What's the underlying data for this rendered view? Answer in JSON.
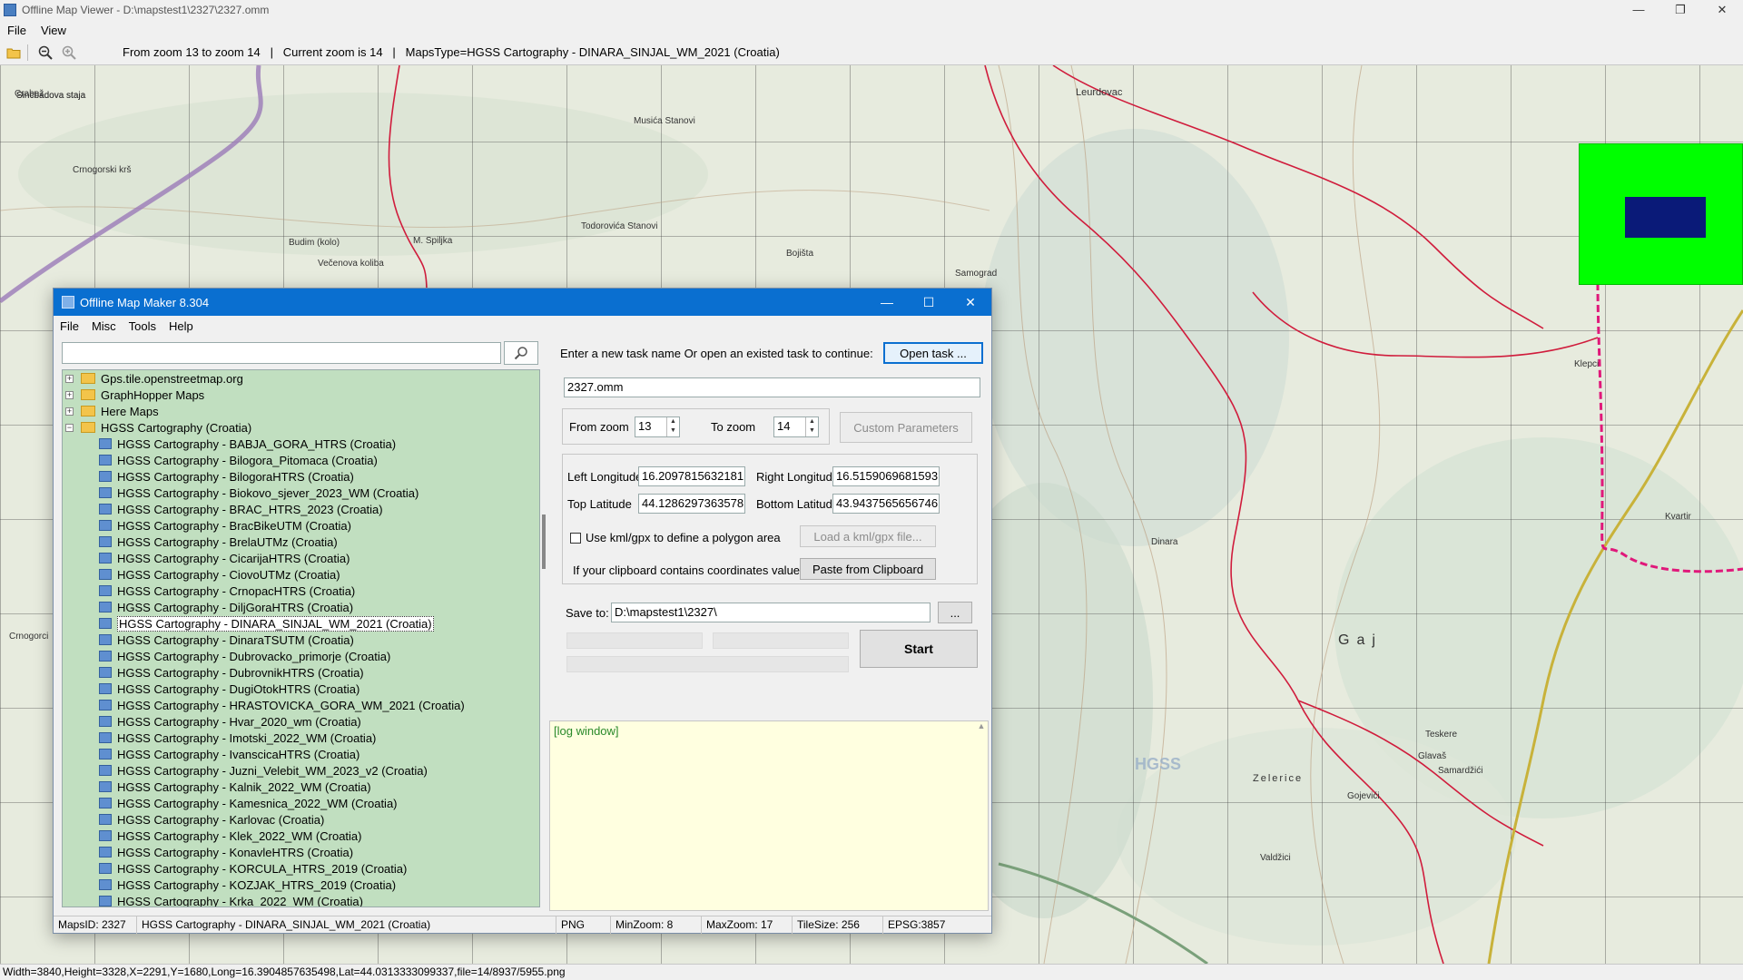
{
  "viewer": {
    "title": "Offline Map Viewer - D:\\mapstest1\\2327\\2327.omm",
    "menu": [
      "File",
      "View"
    ],
    "toolbar_info": "From zoom 13 to zoom 14   |   Current zoom is 14   |   MapsType=HGSS Cartography - DINARA_SINJAL_WM_2021 (Croatia)",
    "status": "Width=3840,Height=3328,X=2291,Y=1680,Long=16.3904857635498,Lat=44.0313333099337,file=14/8937/5955.png",
    "window_controls": [
      "—",
      "❐",
      "✕"
    ]
  },
  "map_labels": [
    "Sincbadova staja",
    "Crabež",
    "Crnogorski krš",
    "Budim (kolo)",
    "Večenova koliba",
    "M. Spiljka",
    "Todorovića Stanovi",
    "Musića Stanovi",
    "Bojišta",
    "Samograd",
    "Leurdovac",
    "Crnogorci",
    "Kvartir",
    "Klepci",
    "Glavaš",
    "Samardžići",
    "Teskere",
    "Valdžici",
    "Zelerice",
    "Gojevići",
    "Gaj",
    "Dinara",
    "HGSS"
  ],
  "dialog": {
    "title": "Offline Map Maker 8.304",
    "menu": [
      "File",
      "Misc",
      "Tools",
      "Help"
    ],
    "search_value": "",
    "tree": {
      "groups": [
        {
          "label": "Gps.tile.openstreetmap.org",
          "expanded": false
        },
        {
          "label": "GraphHopper Maps",
          "expanded": false
        },
        {
          "label": "Here Maps",
          "expanded": false
        },
        {
          "label": "HGSS Cartography (Croatia)",
          "expanded": true
        }
      ],
      "items": [
        "HGSS Cartography - BABJA_GORA_HTRS (Croatia)",
        "HGSS Cartography - Bilogora_Pitomaca (Croatia)",
        "HGSS Cartography - BilogoraHTRS (Croatia)",
        "HGSS Cartography - Biokovo_sjever_2023_WM (Croatia)",
        "HGSS Cartography - BRAC_HTRS_2023 (Croatia)",
        "HGSS Cartography - BracBikeUTM (Croatia)",
        "HGSS Cartography - BrelaUTMz (Croatia)",
        "HGSS Cartography - CicarijaHTRS (Croatia)",
        "HGSS Cartography - CiovoUTMz (Croatia)",
        "HGSS Cartography - CrnopacHTRS (Croatia)",
        "HGSS Cartography - DiljGoraHTRS (Croatia)",
        "HGSS Cartography - DINARA_SINJAL_WM_2021 (Croatia)",
        "HGSS Cartography - DinaraTSUTM (Croatia)",
        "HGSS Cartography - Dubrovacko_primorje (Croatia)",
        "HGSS Cartography - DubrovnikHTRS (Croatia)",
        "HGSS Cartography - DugiOtokHTRS (Croatia)",
        "HGSS Cartography - HRASTOVICKA_GORA_WM_2021 (Croatia)",
        "HGSS Cartography - Hvar_2020_wm (Croatia)",
        "HGSS Cartography - Imotski_2022_WM (Croatia)",
        "HGSS Cartography - IvanscicaHTRS (Croatia)",
        "HGSS Cartography - Juzni_Velebit_WM_2023_v2 (Croatia)",
        "HGSS Cartography - Kalnik_2022_WM (Croatia)",
        "HGSS Cartography - Kamesnica_2022_WM (Croatia)",
        "HGSS Cartography - Karlovac (Croatia)",
        "HGSS Cartography - Klek_2022_WM (Croatia)",
        "HGSS Cartography - KonavleHTRS (Croatia)",
        "HGSS Cartography - KORCULA_HTRS_2019 (Croatia)",
        "HGSS Cartography - KOZJAK_HTRS_2019 (Croatia)",
        "HGSS Cartography - Krka_2022_WM (Croatia)"
      ],
      "selected_index": 11
    },
    "task_prompt": "Enter a new task name Or open an existed task to continue:",
    "open_task_label": "Open task ...",
    "task_name": "2327.omm",
    "from_zoom_label": "From zoom",
    "from_zoom": "13",
    "to_zoom_label": "To zoom",
    "to_zoom": "14",
    "custom_params_label": "Custom Parameters",
    "left_lon_label": "Left Longitude",
    "left_lon": "16.2097815632181",
    "right_lon_label": "Right Longitude",
    "right_lon": "16.5159069681593",
    "top_lat_label": "Top Latitude",
    "top_lat": "44.1286297363578",
    "bottom_lat_label": "Bottom Latitude",
    "bottom_lat": "43.9437565656746",
    "kml_label": "Use kml/gpx to define a polygon area",
    "kml_checked": false,
    "load_kml_label": "Load a kml/gpx file...",
    "clipboard_label": "If your clipboard contains coordinates values:",
    "paste_label": "Paste from Clipboard",
    "save_to_label": "Save to:",
    "save_to": "D:\\mapstest1\\2327\\",
    "browse_label": "...",
    "start_label": "Start",
    "log_text": "[log window]",
    "status": {
      "maps_id": "MapsID: 2327",
      "map_name": "HGSS Cartography - DINARA_SINJAL_WM_2021 (Croatia)",
      "format": "PNG",
      "min_zoom": "MinZoom: 8",
      "max_zoom": "MaxZoom: 17",
      "tile_size": "TileSize: 256",
      "epsg": "EPSG:3857"
    },
    "window_controls": [
      "—",
      "☐",
      "✕"
    ]
  },
  "icons": {
    "open": "folder-open-icon",
    "zoom_out": "zoom-out-icon",
    "zoom_in": "zoom-in-icon",
    "search": "search-icon"
  },
  "colors": {
    "title_bar": "#0a6fd0",
    "tree_bg": "#c1dfc0",
    "log_bg": "#ffffe0",
    "minimap_bg": "#00ff00",
    "minimap_view": "#0a1a78",
    "trail": "#d01c3c",
    "boundary": "#e0187a"
  }
}
